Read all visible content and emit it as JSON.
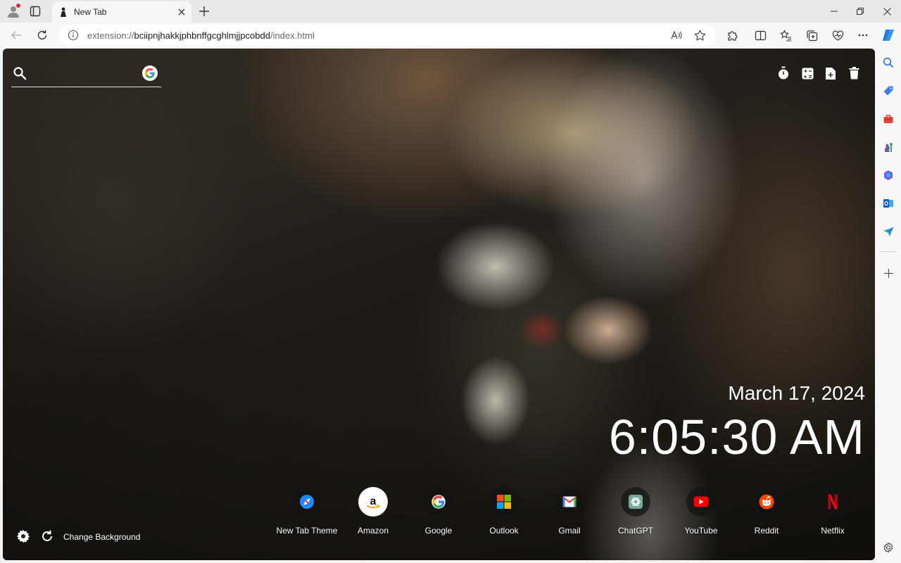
{
  "tab": {
    "title": "New Tab"
  },
  "address": {
    "scheme": "extension://",
    "host": "bciipnjhakkjphbnffgcghlmjjpcobdd",
    "path": "/index.html"
  },
  "newtab": {
    "search": {
      "placeholder": ""
    },
    "date": "March 17, 2024",
    "time": "6:05:30 AM",
    "shortcuts": [
      {
        "label": "New Tab Theme",
        "icon": "compass-icon"
      },
      {
        "label": "Amazon",
        "icon": "amazon-icon"
      },
      {
        "label": "Google",
        "icon": "google-icon"
      },
      {
        "label": "Outlook",
        "icon": "microsoft-icon"
      },
      {
        "label": "Gmail",
        "icon": "gmail-icon"
      },
      {
        "label": "ChatGPT",
        "icon": "chatgpt-icon"
      },
      {
        "label": "YouTube",
        "icon": "youtube-icon"
      },
      {
        "label": "Reddit",
        "icon": "reddit-icon"
      },
      {
        "label": "Netflix",
        "icon": "netflix-icon"
      }
    ],
    "change_background": "Change Background"
  },
  "colors": {
    "accent": "#0078d4",
    "profile_dot": "#d93025",
    "youtube": "#ff0000",
    "netflix": "#e50914",
    "reddit": "#ff4500"
  }
}
